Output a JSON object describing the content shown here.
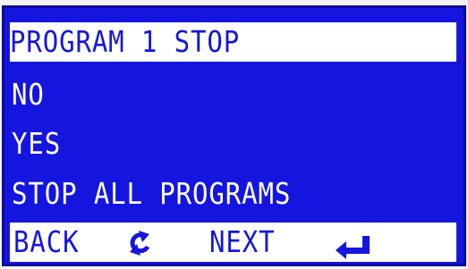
{
  "screen": {
    "title": "PROGRAM 1 STOP",
    "options": [
      {
        "label": "NO"
      },
      {
        "label": "YES"
      },
      {
        "label": "STOP ALL PROGRAMS"
      }
    ],
    "nav": {
      "back_label": "BACK",
      "next_label": "NEXT",
      "back_icon": "undo-arrow-icon",
      "next_icon": "enter-return-icon"
    }
  },
  "colors": {
    "screen_bg": "#1515e0",
    "text": "#ffffff",
    "highlight_bg": "#ffffff"
  }
}
